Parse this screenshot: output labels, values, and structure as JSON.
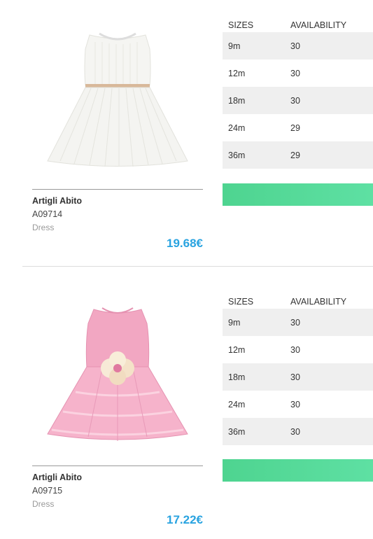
{
  "products": [
    {
      "name": "Artigli Abito",
      "code": "A09714",
      "type": "Dress",
      "price": "19.68€",
      "dress_color": "#f4f4f0",
      "headers": {
        "size": "SIZES",
        "availability": "AVAILABILITY"
      },
      "rows": [
        {
          "size": "9m",
          "qty": "30"
        },
        {
          "size": "12m",
          "qty": "30"
        },
        {
          "size": "18m",
          "qty": "30"
        },
        {
          "size": "24m",
          "qty": "29"
        },
        {
          "size": "36m",
          "qty": "29"
        }
      ]
    },
    {
      "name": "Artigli Abito",
      "code": "A09715",
      "type": "Dress",
      "price": "17.22€",
      "dress_color": "#f4a9c4",
      "headers": {
        "size": "SIZES",
        "availability": "AVAILABILITY"
      },
      "rows": [
        {
          "size": "9m",
          "qty": "30"
        },
        {
          "size": "12m",
          "qty": "30"
        },
        {
          "size": "18m",
          "qty": "30"
        },
        {
          "size": "24m",
          "qty": "30"
        },
        {
          "size": "36m",
          "qty": "30"
        }
      ]
    }
  ],
  "colors": {
    "price": "#29a3e0",
    "cta": "#54d99a"
  }
}
